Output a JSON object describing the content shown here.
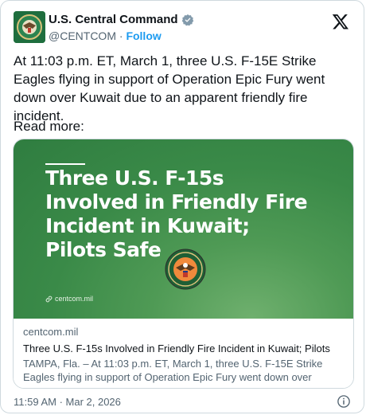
{
  "account": {
    "display_name": "U.S. Central Command",
    "handle": "@CENTCOM",
    "separator": " · ",
    "follow_label": "Follow"
  },
  "post": {
    "text": "At 11:03 p.m. ET, March 1, three U.S. F-15E Strike Eagles flying in support of Operation Epic Fury went down over Kuwait due to an apparent friendly fire incident.",
    "read_more": "Read more:",
    "timestamp": "11:59 AM · Mar 2, 2026"
  },
  "link_card": {
    "image_title": "Three U.S. F-15s Involved in Friendly Fire Incident in Kuwait; Pilots Safe",
    "image_domain": "centcom.mil",
    "seal_text": "UNITED STATES CENTRAL COMMAND",
    "domain": "centcom.mil",
    "title": "Three U.S. F-15s Involved in Friendly Fire Incident in Kuwait; Pilots",
    "description": "TAMPA, Fla. – At 11:03 p.m. ET, March 1, three U.S. F-15E Strike Eagles flying in support of Operation Epic Fury went down over Kuwait due to ..."
  },
  "colors": {
    "link_blue": "#1d9bf0",
    "muted": "#536471",
    "thumb_green": "#3a8a48"
  },
  "icons": [
    "centcom-avatar-icon",
    "verified-badge-icon",
    "x-logo-icon",
    "link-icon",
    "centcom-seal-icon",
    "info-icon"
  ]
}
